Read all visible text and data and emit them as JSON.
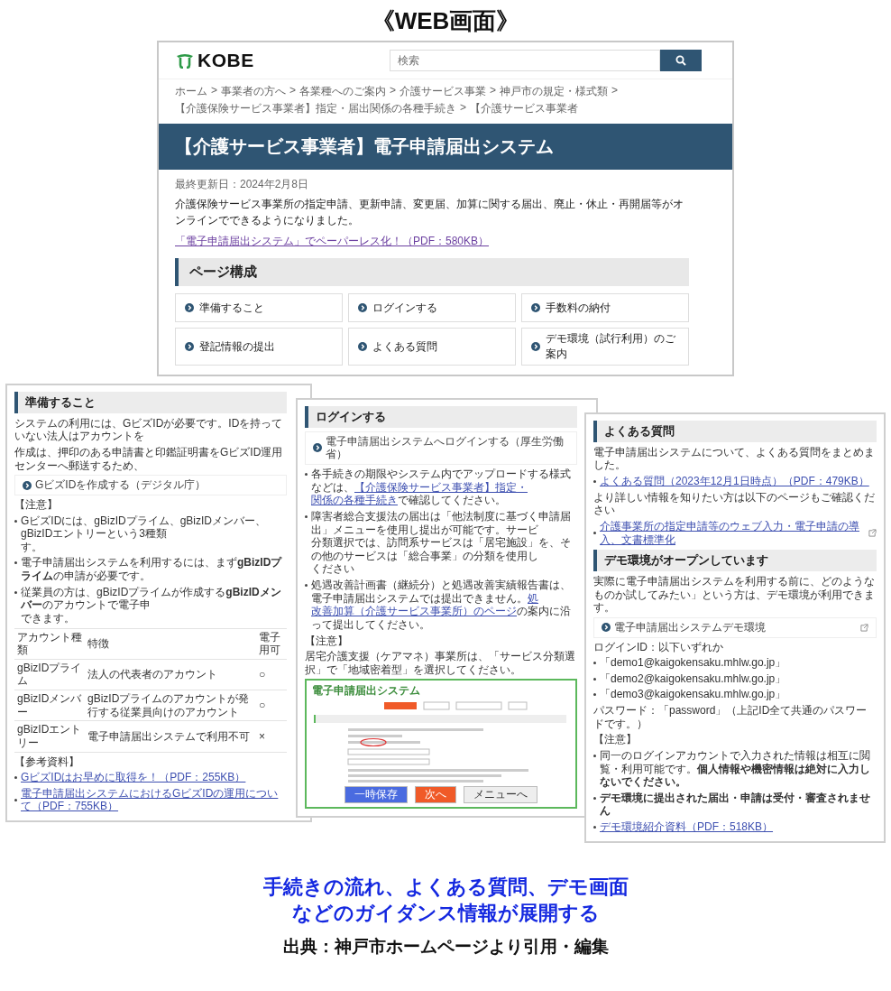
{
  "title": "《WEB画面》",
  "site": {
    "logo": "KOBE",
    "search": {
      "placeholder": "検索"
    },
    "breadcrumb": {
      "separator": ">",
      "items": [
        "ホーム",
        "事業者の方へ",
        "各業種へのご案内",
        "介護サービス事業",
        "神戸市の規定・様式類",
        "【介護保険サービス事業者】指定・届出関係の各種手続き",
        "【介護サービス事業者"
      ]
    },
    "page_title": "【介護サービス事業者】電子申請届出システム",
    "updated": "最終更新日：2024年2月8日",
    "intro": "介護保険サービス事業所の指定申請、更新申請、変更届、加算に関する届出、廃止・休止・再開届等がオンラインでできるようになりました。",
    "intro_link": "「電子申請届出システム」でペーパーレス化！（PDF：580KB）",
    "section_heading": "ページ構成",
    "menu": [
      {
        "label": "準備すること"
      },
      {
        "label": "ログインする"
      },
      {
        "label": "手数料の納付"
      },
      {
        "label": "登記情報の提出"
      },
      {
        "label": "よくある質問"
      },
      {
        "label": "デモ環境（試行利用）のご案内"
      }
    ]
  },
  "panels": [
    {
      "blocks": [
        {
          "kind": "heading",
          "text": "準備すること"
        },
        {
          "kind": "text",
          "text": "システムの利用には、GビズIDが必要です。IDを持っていない法人はアカウントを"
        },
        {
          "kind": "text",
          "text": "作成は、押印のある申請書と印鑑証明書をGビズID運用センターへ郵送するため、"
        },
        {
          "kind": "linkbox",
          "text": "GビズIDを作成する（デジタル庁）"
        },
        {
          "kind": "label",
          "text": "【注意】"
        },
        {
          "kind": "bullet",
          "lines": [
            [
              {
                "text": "GビズIDには、gBizIDプライム、gBizIDメンバー、gBizIDエントリーという3種類"
              }
            ],
            [
              {
                "text": "す。"
              }
            ]
          ]
        },
        {
          "kind": "bullet",
          "lines": [
            [
              {
                "text": "電子申請届出システムを利用するには、まず**gBizIDプライム**の申請が必要です。"
              }
            ]
          ]
        },
        {
          "kind": "bullet",
          "lines": [
            [
              {
                "text": "従業員の方は、gBizIDプライムが作成する**gBizIDメンバー**のアカウントで電子申"
              }
            ],
            [
              {
                "text": "できます。"
              }
            ]
          ]
        },
        {
          "kind": "table",
          "columns": [
            "アカウント種類",
            "特徴",
            [
              "電子",
              "用可"
            ]
          ],
          "rows": [
            [
              "gBizIDプライム",
              "法人の代表者のアカウント",
              "○"
            ],
            [
              "gBizIDメンバー",
              "gBizIDプライムのアカウントが発行する従業員向けのアカウント",
              "○"
            ],
            [
              "gBizIDエントリー",
              "電子申請届出システムで利用不可",
              "×"
            ]
          ]
        },
        {
          "kind": "label",
          "text": "【参考資料】"
        },
        {
          "kind": "link",
          "bullet": true,
          "text": "GビズIDはお早めに取得を！（PDF：255KB）"
        },
        {
          "kind": "link",
          "bullet": true,
          "text": "電子申請届出システムにおけるGビズIDの運用について（PDF：755KB）"
        }
      ]
    },
    {
      "blocks": [
        {
          "kind": "heading",
          "text": "ログインする"
        },
        {
          "kind": "linkbox",
          "text": "電子申請届出システムへログインする（厚生労働省）"
        },
        {
          "kind": "bullet",
          "lines": [
            [
              {
                "text": "各手続きの期限やシステム内でアップロードする様式などは、"
              },
              {
                "text": "【介護保険サービス事業者】指定・",
                "link": true
              }
            ],
            [
              {
                "text": "関係の各種手続き",
                "link": true
              },
              {
                "text": "で確認してください。"
              }
            ]
          ]
        },
        {
          "kind": "bullet",
          "lines": [
            [
              {
                "text": "障害者総合支援法の届出は「他法制度に基づく申請届出」メニューを使用し提出が可能です。サービ"
              }
            ],
            [
              {
                "text": "分類選択では、訪問系サービスは「居宅施設」を、その他のサービスは「総合事業」の分類を使用し"
              }
            ],
            [
              {
                "text": "ください"
              }
            ]
          ]
        },
        {
          "kind": "bullet",
          "lines": [
            [
              {
                "text": "処遇改善計画書（継続分）と処遇改善実績報告書は、電子申請届出システムでは提出できません。"
              },
              {
                "text": "処",
                "link": true
              }
            ],
            [
              {
                "text": "改善加算（介護サービス事業所）のページ",
                "link": true
              },
              {
                "text": "の案内に沿って提出してください。"
              }
            ]
          ]
        },
        {
          "kind": "label",
          "text": "【注意】"
        },
        {
          "kind": "text",
          "text": "居宅介護支援（ケアマネ）事業所は、「サービス分類選択」で「地域密着型」を選択してください。"
        },
        {
          "kind": "embedded",
          "title": "電子申請届出システム",
          "buttons": [
            {
              "label": "一時保存",
              "color": "#4a6be0"
            },
            {
              "label": "次へ",
              "color": "#f05a28"
            },
            {
              "label": "メニューへ",
              "color": "#eeeeee"
            }
          ]
        }
      ]
    },
    {
      "blocks": [
        {
          "kind": "heading",
          "text": "よくある質問"
        },
        {
          "kind": "text",
          "text": "電子申請届出システムについて、よくある質問をまとめました。"
        },
        {
          "kind": "link",
          "bullet": true,
          "text": "よくある質問（2023年12月1日時点）（PDF：479KB）"
        },
        {
          "kind": "text",
          "text": "より詳しい情報を知りたい方は以下のページもご確認ください"
        },
        {
          "kind": "link",
          "bullet": true,
          "external": true,
          "text": "介護事業所の指定申請等のウェブ入力・電子申請の導入、文書標準化"
        },
        {
          "kind": "heading",
          "text": "デモ環境がオープンしています"
        },
        {
          "kind": "text",
          "text": "実際に電子申請届出システムを利用する前に、どのようなものか試してみたい」という方は、デモ環境が利用できます。"
        },
        {
          "kind": "linkbox",
          "external": true,
          "text": "電子申請届出システムデモ環境"
        },
        {
          "kind": "text",
          "text": "ログインID：以下いずれか"
        },
        {
          "kind": "bullet",
          "lines": [
            [
              {
                "text": "「demo1@kaigokensaku.mhlw.go.jp」"
              }
            ]
          ]
        },
        {
          "kind": "bullet",
          "lines": [
            [
              {
                "text": "「demo2@kaigokensaku.mhlw.go.jp」"
              }
            ]
          ]
        },
        {
          "kind": "bullet",
          "lines": [
            [
              {
                "text": "「demo3@kaigokensaku.mhlw.go.jp」"
              }
            ]
          ]
        },
        {
          "kind": "text",
          "text": "パスワード：「password」（上記ID全て共通のパスワードです。）"
        },
        {
          "kind": "label",
          "text": "【注意】"
        },
        {
          "kind": "bullet",
          "lines": [
            [
              {
                "text": "同一のログインアカウントで入力された情報は相互に閲覧・利用可能です。**個人情報や機密情報は絶対に入力しないでください。**"
              }
            ]
          ]
        },
        {
          "kind": "bullet",
          "lines": [
            [
              {
                "text": "**デモ環境に提出された届出・申請は受付・審査されません**"
              }
            ]
          ]
        },
        {
          "kind": "link",
          "bullet": true,
          "text": "デモ環境紹介資料（PDF：518KB）"
        }
      ]
    }
  ],
  "caption": [
    "手続きの流れ、よくある質問、デモ画面",
    "などのガイダンス情報が展開する"
  ],
  "source": "出典：神戸市ホームページより引用・編集"
}
